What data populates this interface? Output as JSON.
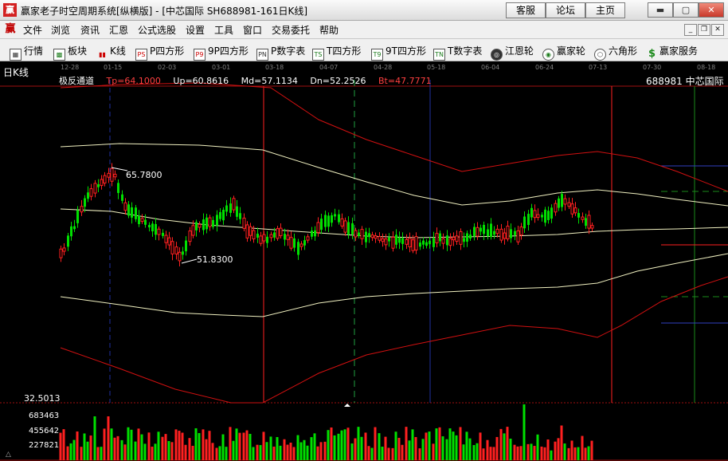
{
  "window": {
    "title": "赢家老子时空周期系统[纵横版] - [中芯国际   SH688981-161日K线]",
    "buttons": [
      "客服",
      "论坛",
      "主页"
    ],
    "controls": [
      "minimize",
      "maximize",
      "close"
    ]
  },
  "menu": {
    "icon": "赢",
    "items": [
      "文件",
      "浏览",
      "资讯",
      "汇恩",
      "公式选股",
      "设置",
      "工具",
      "窗口",
      "交易委托",
      "帮助"
    ]
  },
  "toolbar": {
    "items": [
      {
        "label": "行情",
        "icon": "grid-icon"
      },
      {
        "label": "板块",
        "icon": "blocks-icon"
      },
      {
        "label": "K线",
        "icon": "candle-icon"
      },
      {
        "label": "P四方形",
        "icon": "ps-icon",
        "glyph": "PS"
      },
      {
        "label": "9P四方形",
        "icon": "p9-icon",
        "glyph": "P9"
      },
      {
        "label": "P数字表",
        "icon": "pn-icon",
        "glyph": "PN"
      },
      {
        "label": "T四方形",
        "icon": "ts-icon",
        "glyph": "TS"
      },
      {
        "label": "9T四方形",
        "icon": "t9-icon",
        "glyph": "T9"
      },
      {
        "label": "T数字表",
        "icon": "tn-icon",
        "glyph": "TN"
      },
      {
        "label": "江恩轮",
        "icon": "gann-wheel-icon"
      },
      {
        "label": "赢家轮",
        "icon": "winner-wheel-icon"
      },
      {
        "label": "六角形",
        "icon": "hexagon-icon"
      },
      {
        "label": "赢家服务",
        "icon": "dollar-icon"
      }
    ]
  },
  "chart": {
    "period": "日K线",
    "indicator": "极反通道",
    "tp": "Tp=64.1000",
    "up": "Up=60.8616",
    "md": "Md=57.1134",
    "dn": "Dn=52.2526",
    "bt": "Bt=47.7771",
    "stock": "688981  中芯国际",
    "peak": "65.7800",
    "trough": "51.8300",
    "axis_min": "32.5013",
    "volume_labels": [
      "683463",
      "455642",
      "227821"
    ],
    "dates": [
      "12-28",
      "01-15",
      "02-03",
      "03-01",
      "03-18",
      "04-07",
      "04-28",
      "05-18",
      "06-04",
      "06-24",
      "07-13",
      "07-30",
      "08-18"
    ],
    "colors": {
      "up": "#ff2020",
      "down": "#00e000",
      "channel_outer": "#d01010",
      "channel_inner": "#f0f0c0"
    }
  }
}
